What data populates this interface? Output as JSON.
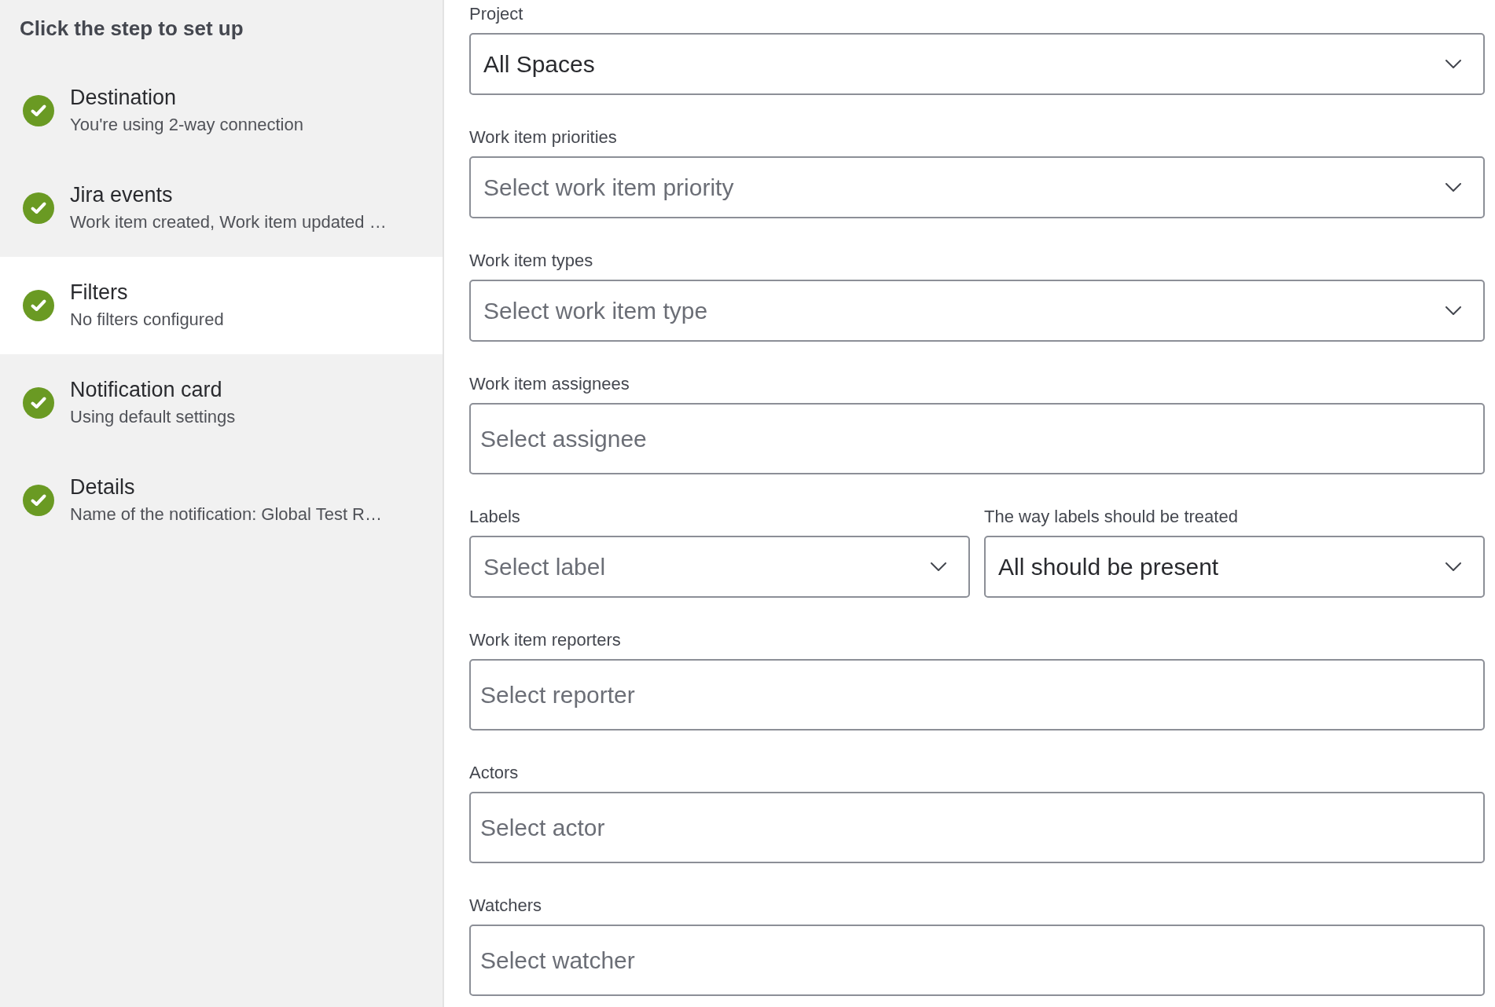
{
  "sidebar": {
    "heading": "Click the step to set up",
    "steps": [
      {
        "title": "Destination",
        "subtitle": "You're using 2-way connection",
        "completed": true,
        "selected": false
      },
      {
        "title": "Jira events",
        "subtitle": "Work item created, Work item updated …",
        "completed": true,
        "selected": false
      },
      {
        "title": "Filters",
        "subtitle": "No filters configured",
        "completed": true,
        "selected": true
      },
      {
        "title": "Notification card",
        "subtitle": "Using default settings",
        "completed": true,
        "selected": false
      },
      {
        "title": "Details",
        "subtitle": "Name of the notification: Global Test R…",
        "completed": true,
        "selected": false
      }
    ]
  },
  "form": {
    "rows": [
      {
        "fields": [
          {
            "label": "Project",
            "kind": "select",
            "value": "All Spaces"
          }
        ]
      },
      {
        "fields": [
          {
            "label": "Work item priorities",
            "kind": "select",
            "placeholder": "Select work item priority"
          }
        ]
      },
      {
        "fields": [
          {
            "label": "Work item types",
            "kind": "select",
            "placeholder": "Select work item type"
          }
        ]
      },
      {
        "fields": [
          {
            "label": "Work item assignees",
            "kind": "picker",
            "placeholder": "Select assignee"
          }
        ]
      },
      {
        "fields": [
          {
            "label": "Labels",
            "kind": "select",
            "placeholder": "Select label"
          },
          {
            "label": "The way labels should be treated",
            "kind": "select",
            "value": "All should be present"
          }
        ]
      },
      {
        "fields": [
          {
            "label": "Work item reporters",
            "kind": "picker",
            "placeholder": "Select reporter"
          }
        ]
      },
      {
        "fields": [
          {
            "label": "Actors",
            "kind": "picker",
            "placeholder": "Select actor"
          }
        ]
      },
      {
        "fields": [
          {
            "label": "Watchers",
            "kind": "picker",
            "placeholder": "Select watcher"
          }
        ]
      }
    ]
  }
}
